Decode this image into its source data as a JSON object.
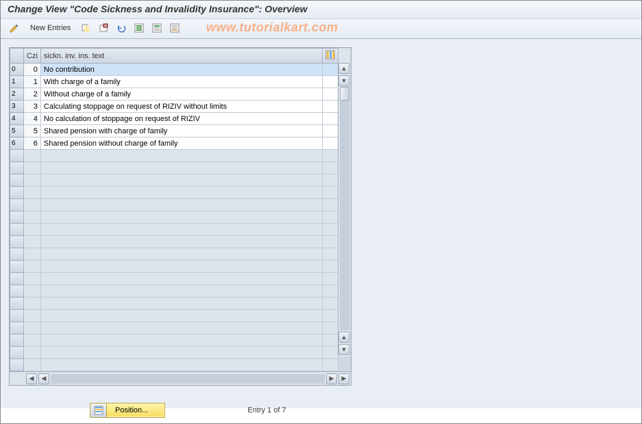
{
  "header": {
    "title": "Change View \"Code Sickness and Invalidity Insurance\": Overview"
  },
  "toolbar": {
    "new_entries_label": "New Entries"
  },
  "watermark": "www.tutorialkart.com",
  "table": {
    "columns": {
      "czi": "Czi",
      "text": "sickn. inv. ins. text"
    },
    "rows": [
      {
        "sel": "0",
        "czi": "0",
        "text": "No contribution",
        "selected": true
      },
      {
        "sel": "1",
        "czi": "1",
        "text": "With charge of a family",
        "selected": false
      },
      {
        "sel": "2",
        "czi": "2",
        "text": "Without charge of a family",
        "selected": false
      },
      {
        "sel": "3",
        "czi": "3",
        "text": "Calculating stoppage on request of RIZIV without limits",
        "selected": false
      },
      {
        "sel": "4",
        "czi": "4",
        "text": "No calculation of stoppage on request of RIZIV",
        "selected": false
      },
      {
        "sel": "5",
        "czi": "5",
        "text": "Shared pension with charge of family",
        "selected": false
      },
      {
        "sel": "6",
        "czi": "6",
        "text": "Shared pension without charge of family",
        "selected": false
      }
    ],
    "empty_rows": 18
  },
  "footer": {
    "position_label": "Position...",
    "entry_status": "Entry 1 of 7"
  }
}
